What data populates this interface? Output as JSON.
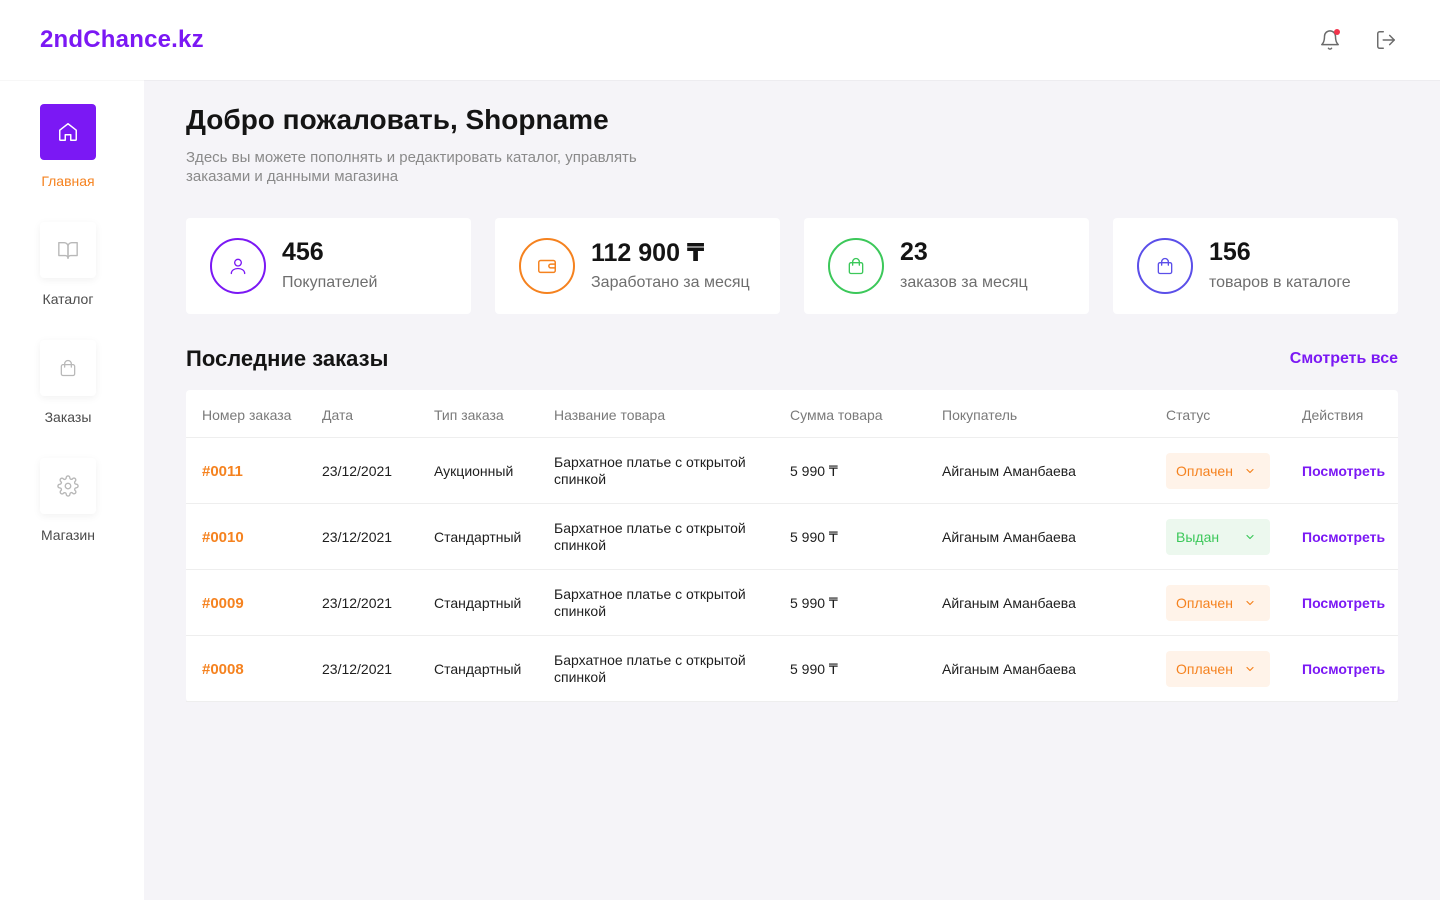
{
  "app": {
    "logo": "2ndChance.kz"
  },
  "header": {
    "notification_icon": "bell-icon",
    "logout_icon": "logout-icon"
  },
  "sidebar": {
    "items": [
      {
        "label": "Главная",
        "icon": "home-icon",
        "active": true
      },
      {
        "label": "Каталог",
        "icon": "book-icon",
        "active": false
      },
      {
        "label": "Заказы",
        "icon": "bag-icon",
        "active": false
      },
      {
        "label": "Магазин",
        "icon": "gear-icon",
        "active": false
      }
    ]
  },
  "main": {
    "title": "Добро пожаловать, Shopname",
    "subtitle": "Здесь вы можете пополнять и редактировать каталог, управлять заказами и данными магазина",
    "stats": [
      {
        "value": "456",
        "label": "Покупателей",
        "icon": "user-icon",
        "color": "#7B18F4"
      },
      {
        "value": "112 900 ₸",
        "label": "Заработано за месяц",
        "icon": "wallet-icon",
        "color": "#F5821F"
      },
      {
        "value": "23",
        "label": "заказов за месяц",
        "icon": "bag-icon",
        "color": "#3CC85A"
      },
      {
        "value": "156",
        "label": "товаров в каталоге",
        "icon": "bag-icon",
        "color": "#5B4FE9"
      }
    ],
    "orders_title": "Последние заказы",
    "view_all": "Смотреть все",
    "table": {
      "headers": [
        "Номер заказа",
        "Дата",
        "Тип заказа",
        "Название товара",
        "Сумма товара",
        "Покупатель",
        "Статус",
        "Действия"
      ],
      "rows": [
        {
          "number": "#0011",
          "date": "23/12/2021",
          "type": "Аукционный",
          "product": "Бархатное платье с открытой спинкой",
          "sum": "5 990 ₸",
          "buyer": "Айганым Аманбаева",
          "status": "Оплачен",
          "status_kind": "paid",
          "action": "Посмотреть"
        },
        {
          "number": "#0010",
          "date": "23/12/2021",
          "type": "Стандартный",
          "product": "Бархатное платье с открытой спинкой",
          "sum": "5 990 ₸",
          "buyer": "Айганым Аманбаева",
          "status": "Выдан",
          "status_kind": "issued",
          "action": "Посмотреть"
        },
        {
          "number": "#0009",
          "date": "23/12/2021",
          "type": "Стандартный",
          "product": "Бархатное платье с открытой спинкой",
          "sum": "5 990 ₸",
          "buyer": "Айганым Аманбаева",
          "status": "Оплачен",
          "status_kind": "paid",
          "action": "Посмотреть"
        },
        {
          "number": "#0008",
          "date": "23/12/2021",
          "type": "Стандартный",
          "product": "Бархатное платье с открытой спинкой",
          "sum": "5 990 ₸",
          "buyer": "Айганым Аманбаева",
          "status": "Оплачен",
          "status_kind": "paid",
          "action": "Посмотреть"
        }
      ]
    }
  },
  "colors": {
    "accent": "#7B18F4",
    "orange": "#F5821F",
    "green": "#3CC85A",
    "indigo": "#5B4FE9",
    "background": "#F5F4F8"
  }
}
